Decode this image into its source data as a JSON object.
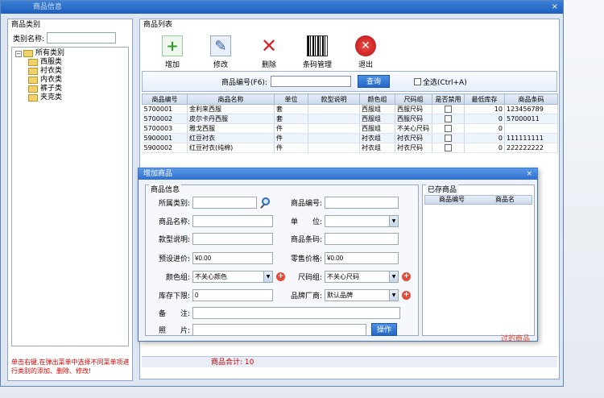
{
  "window": {
    "title": "商品信息",
    "close": "×"
  },
  "left_panel": {
    "header": "商品类别",
    "search_label": "类别名称:",
    "tree_root": "所有类别",
    "tree_children": [
      "西服类",
      "衬衣类",
      "内衣类",
      "裤子类",
      "夹克类"
    ],
    "hint": "单击右键,在弹出菜单中选择不同菜单项进行类别的添加、删除、修改!"
  },
  "right_panel": {
    "header": "商品列表",
    "toolbar": [
      {
        "label": "增加",
        "icon": "add-icon"
      },
      {
        "label": "修改",
        "icon": "edit-icon"
      },
      {
        "label": "删除",
        "icon": "delete-icon"
      },
      {
        "label": "条码管理",
        "icon": "barcode-icon"
      },
      {
        "label": "退出",
        "icon": "exit-icon"
      }
    ],
    "search_label": "商品编号(F6):",
    "search_value": "",
    "search_button": "查询",
    "select_all": "全选(Ctrl+A)",
    "columns": [
      "商品编号",
      "商品名称",
      "单位",
      "款型说明",
      "颜色组",
      "尺码组",
      "是否禁用",
      "最低库存",
      "商品条码"
    ],
    "rows": [
      [
        "5700001",
        "金利来西服",
        "套",
        "",
        "西服组",
        "西服尺码",
        "",
        "10",
        "123456789"
      ],
      [
        "5700002",
        "皮尔卡丹西服",
        "套",
        "",
        "西服组",
        "西服尺码",
        "",
        "0",
        "57000011"
      ],
      [
        "5700003",
        "雅戈西服",
        "件",
        "",
        "西服组",
        "不关心尺码",
        "",
        "0",
        ""
      ],
      [
        "5900001",
        "红豆衬衣",
        "件",
        "",
        "衬衣组",
        "衬衣尺码",
        "",
        "0",
        "111111111"
      ],
      [
        "5900002",
        "红豆衬衣(纯棉)",
        "件",
        "",
        "衬衣组",
        "衬衣尺码",
        "",
        "0",
        "222222222"
      ]
    ],
    "footer": "商品合计: 10"
  },
  "dialog": {
    "title": "增加商品",
    "close": "×",
    "info_legend": "商品信息",
    "exist_legend": "已存商品",
    "exist_columns": [
      "商品编号",
      "商品名"
    ],
    "fields": {
      "category": {
        "label": "所属类别:",
        "value": ""
      },
      "code": {
        "label": "商品编号:",
        "value": ""
      },
      "name": {
        "label": "商品名称:",
        "value": ""
      },
      "unit": {
        "label": "单　　位:",
        "value": ""
      },
      "style": {
        "label": "款型说明:",
        "value": ""
      },
      "barcode": {
        "label": "商品条码:",
        "value": ""
      },
      "purchase": {
        "label": "预设进价:",
        "value": "¥0.00"
      },
      "retail": {
        "label": "零售价格:",
        "value": "¥0.00"
      },
      "color": {
        "label": "颜色组:",
        "value": "不关心颜色"
      },
      "size": {
        "label": "尺码组:",
        "value": "不关心尺码"
      },
      "min_stock": {
        "label": "库存下限:",
        "value": "0"
      },
      "brand": {
        "label": "品牌厂商:",
        "value": "默认品牌"
      },
      "note": {
        "label": "备　　注:",
        "value": ""
      },
      "photo": {
        "label": "照　　片:",
        "value": ""
      }
    },
    "photo_button": "操作",
    "bg_snippet": "过的商品"
  }
}
